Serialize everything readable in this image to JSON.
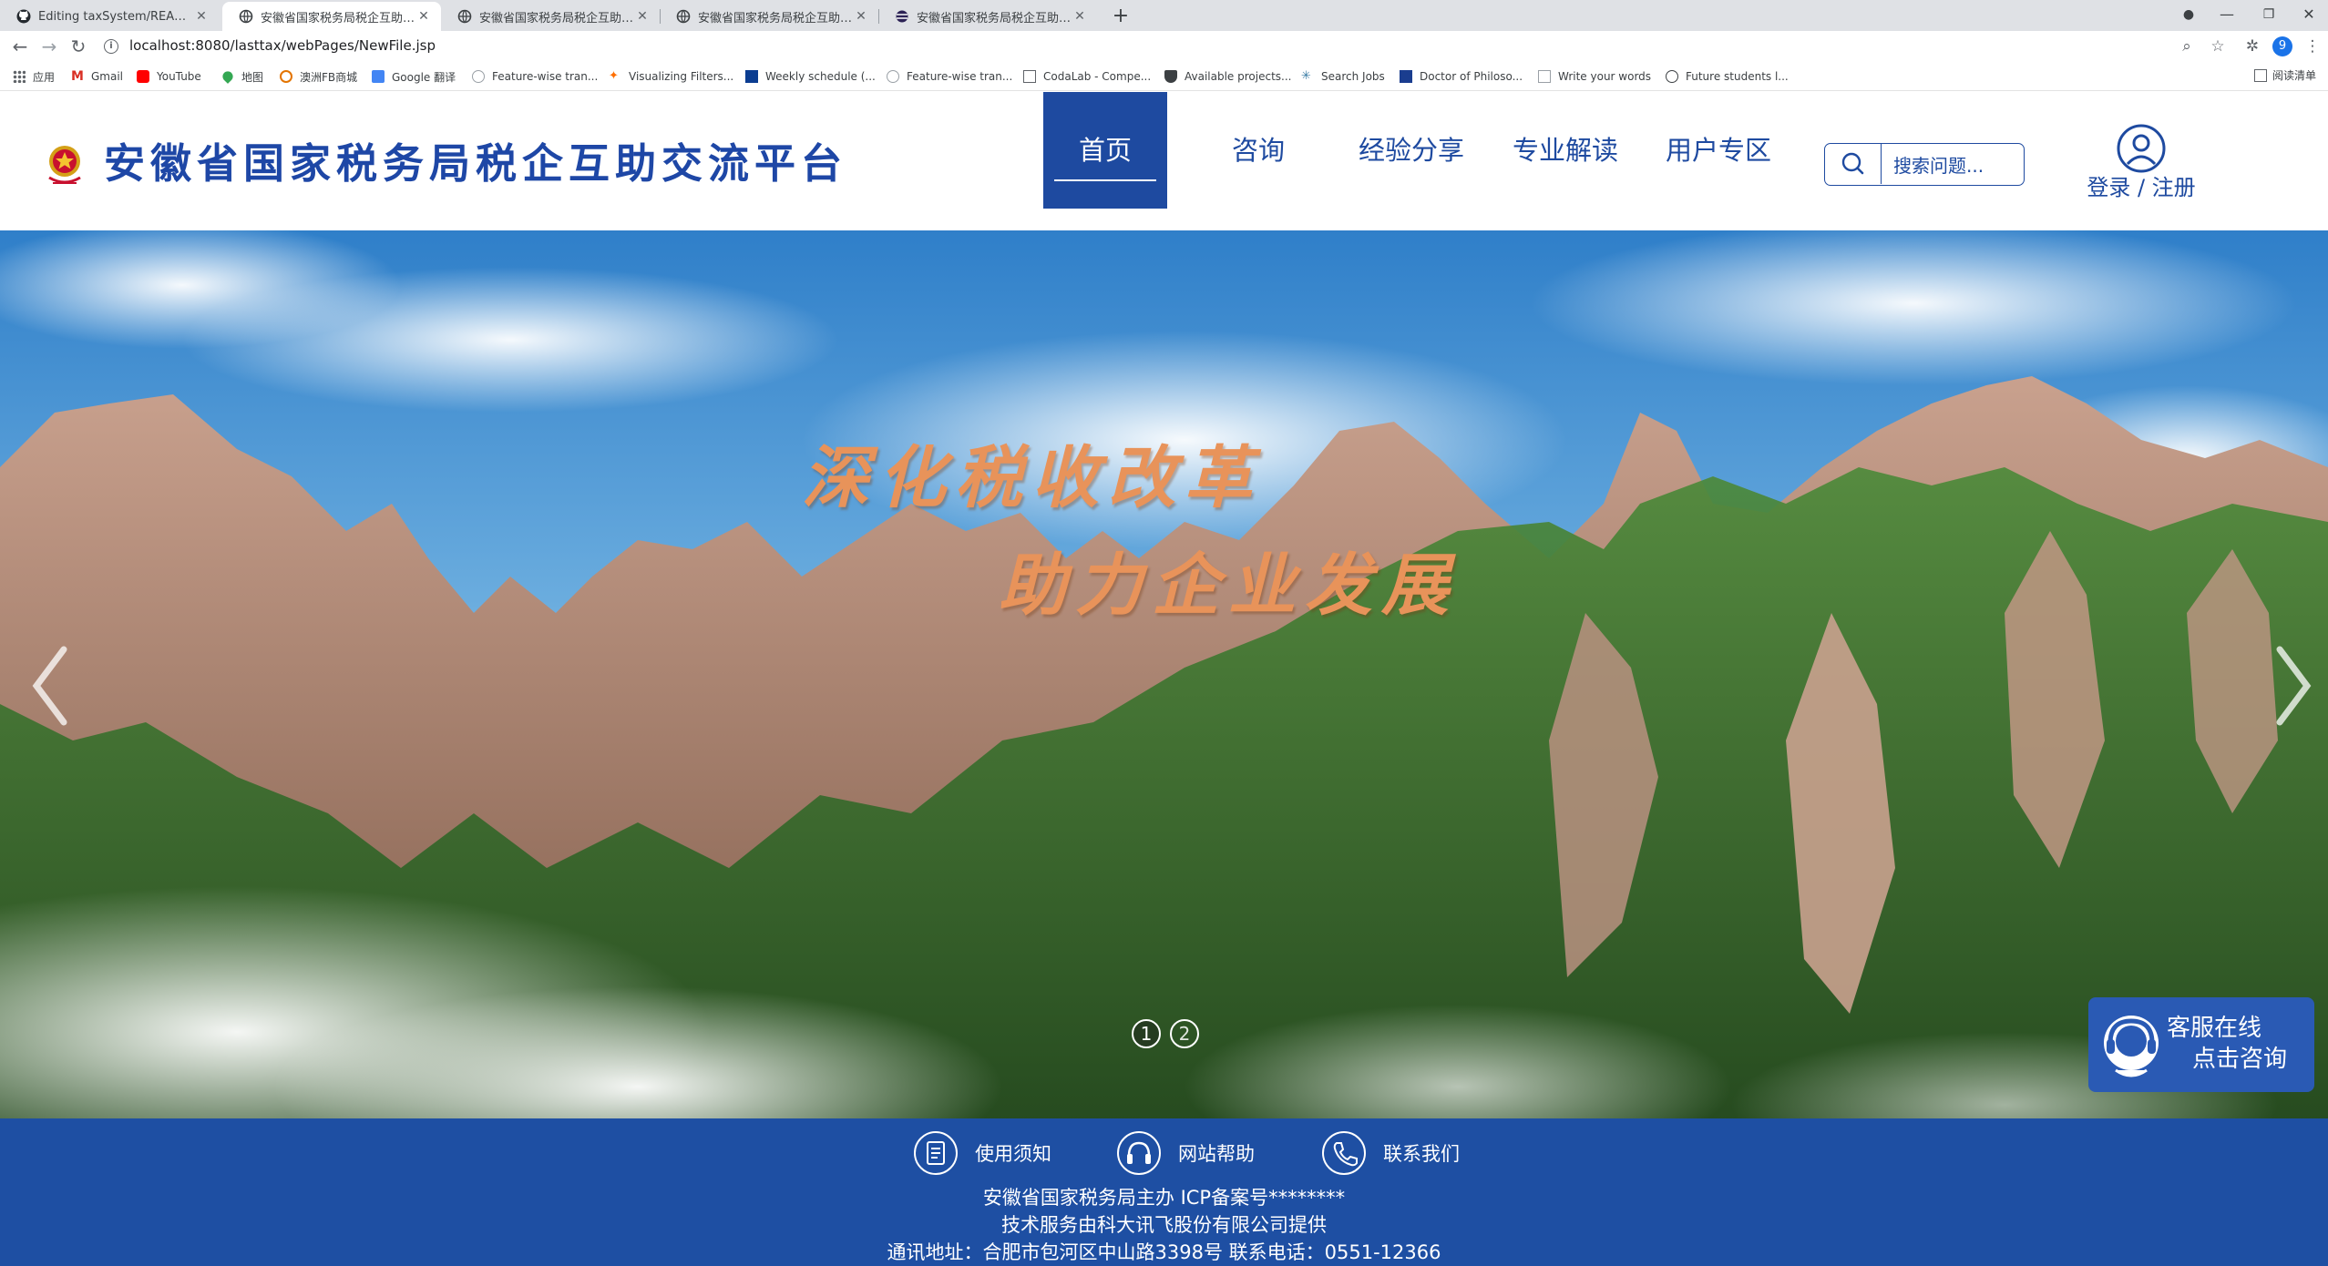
{
  "browser": {
    "tabs": [
      {
        "title": "Editing taxSystem/README.md",
        "icon": "github-icon",
        "active": false
      },
      {
        "title": "安徽省国家税务局税企互助交流平台",
        "icon": "globe-icon",
        "active": true
      },
      {
        "title": "安徽省国家税务局税企互助交流平台",
        "icon": "globe-icon",
        "active": false
      },
      {
        "title": "安徽省国家税务局税企互助交流平台",
        "icon": "globe-icon",
        "active": false
      },
      {
        "title": "安徽省国家税务局税企互助交流平台",
        "icon": "eclipse-icon",
        "active": false
      }
    ],
    "new_tab_label": "+",
    "url": "localhost:8080/lasttax/webPages/NewFile.jsp",
    "profile_initial": "9",
    "bookmarks": [
      {
        "label": "应用",
        "icon": "apps-grid-icon",
        "color": "#5f6368"
      },
      {
        "label": "Gmail",
        "icon": "gmail-icon",
        "color": "#d93025"
      },
      {
        "label": "YouTube",
        "icon": "youtube-icon",
        "color": "#ff0000"
      },
      {
        "label": "地图",
        "icon": "maps-pin-icon",
        "color": "#34a853"
      },
      {
        "label": "澳洲FB商城",
        "icon": "fb-market-icon",
        "color": "#e37400"
      },
      {
        "label": "Google 翻译",
        "icon": "translate-icon",
        "color": "#4285f4"
      },
      {
        "label": "Feature-wise tran...",
        "icon": "page-icon",
        "color": "#9aa0a6"
      },
      {
        "label": "Visualizing Filters...",
        "icon": "tensorflow-icon",
        "color": "#ff6f00"
      },
      {
        "label": "Weekly schedule (...",
        "icon": "schedule-icon",
        "color": "#0b3d91"
      },
      {
        "label": "Feature-wise tran...",
        "icon": "page-icon",
        "color": "#9aa0a6"
      },
      {
        "label": "CodaLab - Compe...",
        "icon": "codalab-icon",
        "color": "#5f6368"
      },
      {
        "label": "Available projects...",
        "icon": "shield-icon",
        "color": "#3c4043"
      },
      {
        "label": "Search Jobs",
        "icon": "jobs-icon",
        "color": "#3a7ca5"
      },
      {
        "label": "Doctor of Philoso...",
        "icon": "uni-icon",
        "color": "#1a3d8f"
      },
      {
        "label": "Write your words",
        "icon": "doc-icon",
        "color": "#9aa0a6"
      },
      {
        "label": "Future students l...",
        "icon": "globe-icon",
        "color": "#3c4043"
      }
    ],
    "reading_list_label": "阅读清单"
  },
  "header": {
    "site_title": "安徽省国家税务局税企互助交流平台",
    "nav": [
      {
        "label": "首页",
        "active": true
      },
      {
        "label": "咨询",
        "active": false
      },
      {
        "label": "经验分享",
        "active": false
      },
      {
        "label": "专业解读",
        "active": false
      },
      {
        "label": "用户专区",
        "active": false
      }
    ],
    "search_placeholder": "搜索问题...",
    "login_label": "登录 / 注册"
  },
  "banner": {
    "slogan_line1": "深化税收改革",
    "slogan_line2": "助力企业发展",
    "dots": [
      "1",
      "2"
    ],
    "active_slide": 1
  },
  "service_widget": {
    "line1": "客服在线",
    "line2": "点击咨询"
  },
  "footer": {
    "links": [
      {
        "label": "使用须知",
        "icon": "document-icon"
      },
      {
        "label": "网站帮助",
        "icon": "headset-icon"
      },
      {
        "label": "联系我们",
        "icon": "phone-icon"
      }
    ],
    "line1": "安徽省国家税务局主办 ICP备案号********",
    "line2": "技术服务由科大讯飞股份有限公司提供",
    "line3": "通讯地址：合肥市包河区中山路3398号 联系电话：0551-12366"
  },
  "colors": {
    "brand_blue": "#1e4aa0",
    "footer_blue": "#1e4fa3",
    "slogan_orange": "#e8935a"
  }
}
